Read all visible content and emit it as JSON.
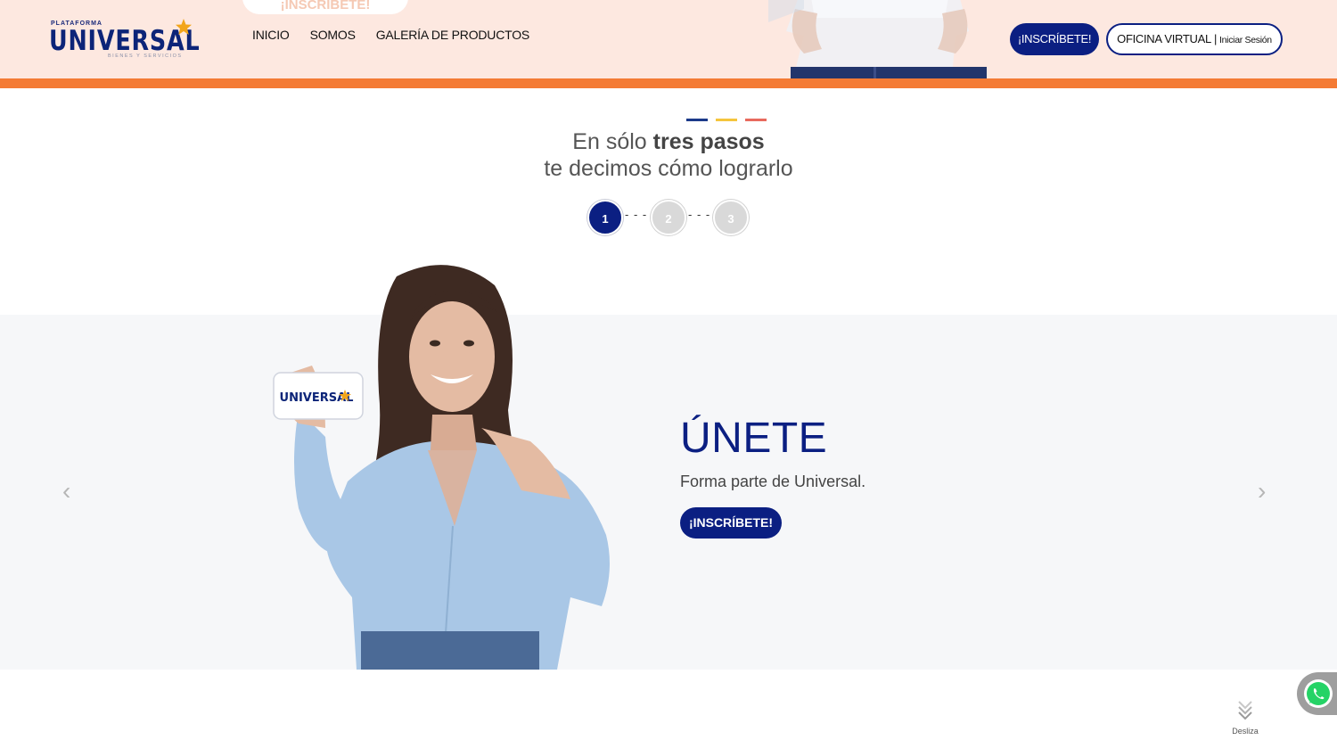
{
  "header": {
    "ghost_button_label": "¡INSCRÍBETE!",
    "logo": {
      "top_text": "PLATAFORMA",
      "main_text": "UNIVERSAL",
      "sub_text": "BIENES Y SERVICIOS"
    },
    "nav": [
      {
        "label": "INICIO"
      },
      {
        "label": "SOMOS"
      },
      {
        "label": "GALERÍA DE PRODUCTOS"
      }
    ],
    "join_button": "¡INSCRÍBETE!",
    "office_button": {
      "main": "OFICINA VIRTUAL",
      "separator": "|",
      "small": "Iniciar Sesión"
    }
  },
  "steps": {
    "title_prefix": "En sólo",
    "title_bold": "tres pasos",
    "title_line2": "te decimos cómo lograrlo",
    "items": [
      {
        "label": "1"
      },
      {
        "label": "2"
      },
      {
        "label": "3"
      }
    ],
    "active": 1,
    "connector": "- - -"
  },
  "carousel": {
    "prev_label": "‹",
    "next_label": "›",
    "slide": {
      "title": "ÚNETE",
      "subtitle": "Forma parte de Universal.",
      "button": "¡INSCRÍBETE!"
    },
    "card_text": "UNIVERSAL"
  },
  "scroll_hint": {
    "label": "Desliza"
  },
  "icons": {
    "whatsapp": "whatsapp-icon",
    "scroll": "chevron-double-down-icon",
    "star": "star-icon"
  },
  "colors": {
    "brand_blue": "#0b1f82",
    "accent_orange": "#f47b35",
    "header_bg": "#fde8e0",
    "dash_colors": [
      "#1c3a8a",
      "#f5c53d",
      "#e86a5e"
    ]
  }
}
